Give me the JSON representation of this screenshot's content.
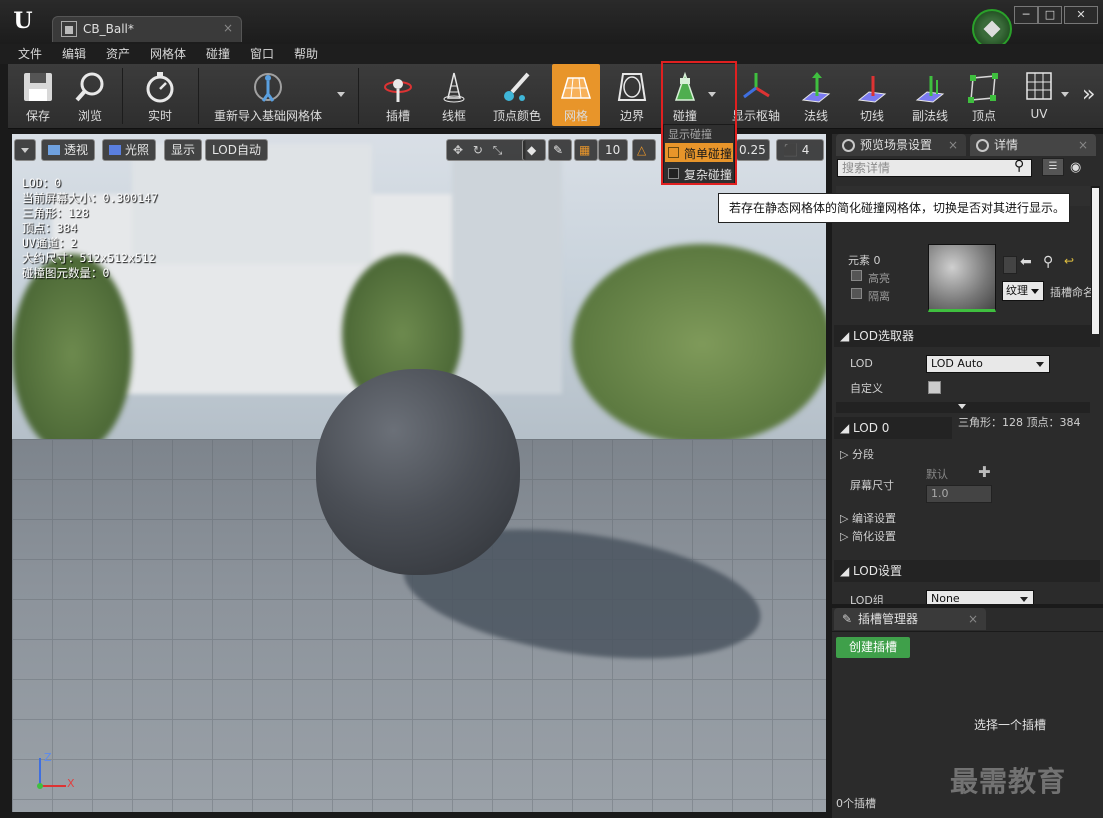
{
  "window": {
    "tab_title": "CB_Ball*",
    "tab_close": "×",
    "min": "─",
    "max": "□",
    "close": "✕"
  },
  "menu": [
    "文件",
    "编辑",
    "资产",
    "网格体",
    "碰撞",
    "窗口",
    "帮助"
  ],
  "toolbar": {
    "save": "保存",
    "browse": "浏览",
    "realtime": "实时",
    "reimport": "重新导入基础网格体",
    "socket": "插槽",
    "wireframe": "线框",
    "vertex_color": "顶点颜色",
    "mesh": "网格",
    "bounds": "边界",
    "collision": "碰撞",
    "pivot": "显示枢轴",
    "normals": "法线",
    "tangents": "切线",
    "binormals": "副法线",
    "vertices": "顶点",
    "uv": "UV",
    "more": "»"
  },
  "colors": {
    "mesh_active": "#e8952a",
    "highlight": "#e02020",
    "create_button": "#3fa04a"
  },
  "viewport": {
    "perspective": "透视",
    "lit": "光照",
    "show": "显示",
    "lod_auto": "LOD自动",
    "grid_snap": "10",
    "rotate_snap_partial": "0.25",
    "camera_speed": "4",
    "stats": [
      "LOD：0",
      "当前屏幕大小：0.300147",
      "三角形：128",
      "顶点：384",
      "UV通道：2",
      "大约尺寸：512x512x512",
      "碰撞图元数量：0"
    ],
    "axis_z": "Z",
    "axis_x": "X"
  },
  "collision_menu": {
    "header": "显示碰撞",
    "simple": "简单碰撞",
    "complex": "复杂碰撞",
    "simple_checked": true,
    "complex_checked": false
  },
  "tooltip": "若存在静态网格体的简化碰撞网格体，切换是否对其进行显示。",
  "details": {
    "tab_preview": "预览场景设置",
    "tab_details": "详情",
    "search_placeholder": "搜索详情",
    "element_label": "元素 0",
    "highlight": "高亮",
    "isolate": "隔离",
    "texture": "纹理",
    "slot_name": "插槽命名",
    "lod_picker": "LOD选取器",
    "lod": "LOD",
    "lod_value": "LOD Auto",
    "custom": "自定义",
    "lod0": "LOD 0",
    "lod0_stats": "三角形：128   顶点：384",
    "sections": "分段",
    "screen_size": "屏幕尺寸",
    "default": "默认",
    "screen_size_value": "1.0",
    "build_settings": "编译设置",
    "reduction_settings": "简化设置",
    "lod_settings": "LOD设置",
    "lod_group": "LOD组",
    "lod_group_value": "None"
  },
  "sockets": {
    "tab": "插槽管理器",
    "create": "创建插槽",
    "select_prompt": "选择一个插槽",
    "count": "0个插槽"
  },
  "watermark": "最需教育"
}
